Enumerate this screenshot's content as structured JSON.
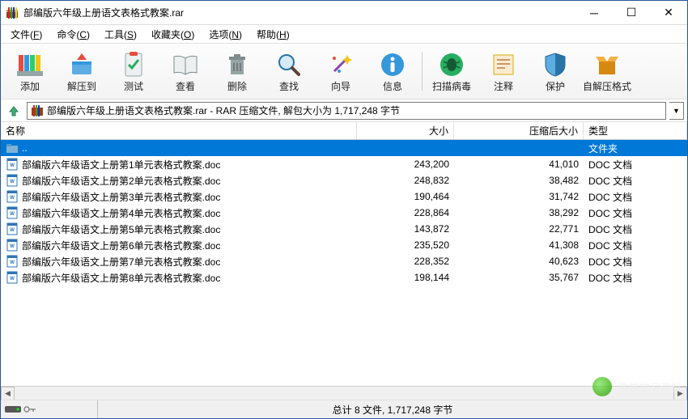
{
  "window": {
    "title": "部编版六年级上册语文表格式教案.rar"
  },
  "menus": [
    {
      "pre": "文件(",
      "u": "F",
      "post": ")"
    },
    {
      "pre": "命令(",
      "u": "C",
      "post": ")"
    },
    {
      "pre": "工具(",
      "u": "S",
      "post": ")"
    },
    {
      "pre": "收藏夹(",
      "u": "O",
      "post": ")"
    },
    {
      "pre": "选项(",
      "u": "N",
      "post": ")"
    },
    {
      "pre": "帮助(",
      "u": "H",
      "post": ")"
    }
  ],
  "toolbar": {
    "add": "添加",
    "extract": "解压到",
    "test": "测试",
    "view": "查看",
    "delete": "删除",
    "find": "查找",
    "wizard": "向导",
    "info": "信息",
    "scan": "扫描病毒",
    "comment": "注释",
    "protect": "保护",
    "sfx": "自解压格式"
  },
  "path": {
    "text": "部编版六年级上册语文表格式教案.rar - RAR 压缩文件, 解包大小为 1,717,248 字节"
  },
  "columns": {
    "name": "名称",
    "size": "大小",
    "packed": "压缩后大小",
    "type": "类型"
  },
  "parent": {
    "label": "..",
    "type": "文件夹"
  },
  "files": [
    {
      "name": "部编版六年级语文上册第1单元表格式教案.doc",
      "size": "243,200",
      "packed": "41,010",
      "type": "DOC 文档"
    },
    {
      "name": "部编版六年级语文上册第2单元表格式教案.doc",
      "size": "248,832",
      "packed": "38,482",
      "type": "DOC 文档"
    },
    {
      "name": "部编版六年级语文上册第3单元表格式教案.doc",
      "size": "190,464",
      "packed": "31,742",
      "type": "DOC 文档"
    },
    {
      "name": "部编版六年级语文上册第4单元表格式教案.doc",
      "size": "228,864",
      "packed": "38,292",
      "type": "DOC 文档"
    },
    {
      "name": "部编版六年级语文上册第5单元表格式教案.doc",
      "size": "143,872",
      "packed": "22,771",
      "type": "DOC 文档"
    },
    {
      "name": "部编版六年级语文上册第6单元表格式教案.doc",
      "size": "235,520",
      "packed": "41,308",
      "type": "DOC 文档"
    },
    {
      "name": "部编版六年级语文上册第7单元表格式教案.doc",
      "size": "228,352",
      "packed": "40,623",
      "type": "DOC 文档"
    },
    {
      "name": "部编版六年级语文上册第8单元表格式教案.doc",
      "size": "198,144",
      "packed": "35,767",
      "type": "DOC 文档"
    }
  ],
  "status": {
    "summary": "总计 8 文件, 1,717,248 字节"
  },
  "watermark": {
    "text": "教学学习资料"
  }
}
